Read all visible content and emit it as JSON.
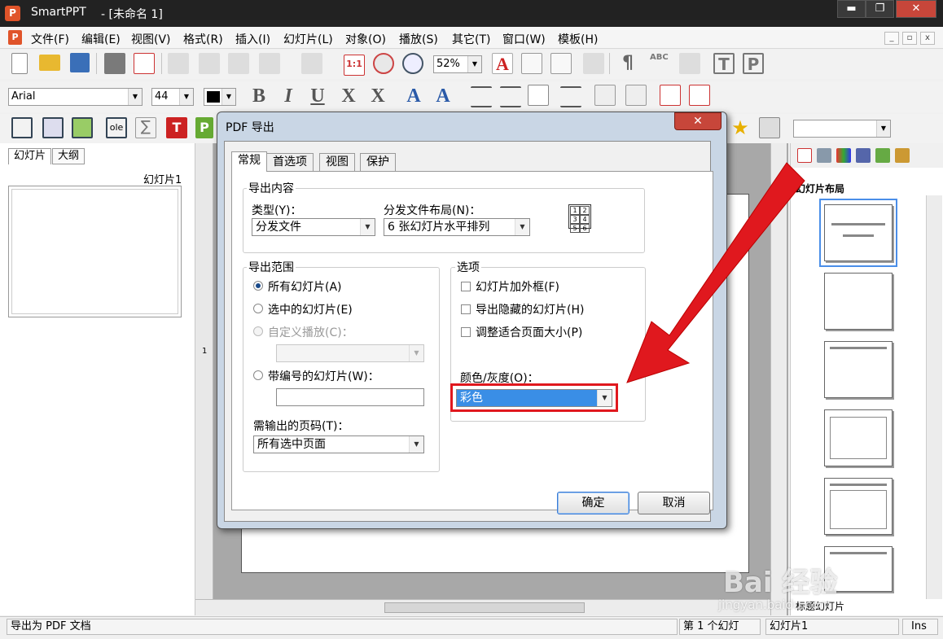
{
  "window": {
    "app_name": "SmartPPT",
    "doc_title": "- [未命名 1]",
    "btn_min": "▬",
    "btn_max": "❐",
    "btn_close": "✕"
  },
  "menu": {
    "items": [
      "文件(F)",
      "编辑(E)",
      "视图(V)",
      "格式(R)",
      "插入(I)",
      "幻灯片(L)",
      "对象(O)",
      "播放(S)",
      "其它(T)",
      "窗口(W)",
      "模板(H)"
    ],
    "mdi_min": "_",
    "mdi_restore": "▫",
    "mdi_close": "x"
  },
  "toolbar": {
    "zoom": "52%",
    "ratio_label": "1:1"
  },
  "format": {
    "font": "Arial",
    "size": "44"
  },
  "left_panel": {
    "tabs": [
      "幻灯片",
      "大纲"
    ],
    "slide_label": "幻灯片1"
  },
  "right_panel": {
    "title": "幻灯片布局",
    "footer": "标题幻灯片"
  },
  "ruler": {
    "marker": "1"
  },
  "status": {
    "message": "导出为 PDF 文档",
    "slide_count": "第 1 个幻灯",
    "slide_name": "幻灯片1",
    "mode": "Ins"
  },
  "dialog": {
    "title": "PDF 导出",
    "close": "✕",
    "tabs": [
      "常规",
      "首选项",
      "视图",
      "保护"
    ],
    "export_content": {
      "label": "导出内容",
      "type_label": "类型(Y)：",
      "type_value": "分发文件",
      "layout_label": "分发文件布局(N)：",
      "layout_value": "6 张幻灯片水平排列",
      "layout_icon": [
        "1",
        "2",
        "3",
        "4",
        "5",
        "6"
      ]
    },
    "export_range": {
      "label": "导出范围",
      "all": "所有幻灯片(A)",
      "selected": "选中的幻灯片(E)",
      "custom": "自定义播放(C)：",
      "numbered": "带编号的幻灯片(W)：",
      "pages_label": "需输出的页码(T)：",
      "pages_value": "所有选中页面"
    },
    "options": {
      "label": "选项",
      "frame": "幻灯片加外框(F)",
      "hidden": "导出隐藏的幻灯片(H)",
      "fit": "调整适合页面大小(P)",
      "color_label": "颜色/灰度(O)：",
      "color_value": "彩色"
    },
    "ok": "确定",
    "cancel": "取消"
  },
  "watermark": {
    "line1": "Bai 经验",
    "line2": "jingyan.baidu.com"
  },
  "colors": {
    "accent_red": "#e0181e",
    "selection_blue": "#3a8ee6"
  }
}
